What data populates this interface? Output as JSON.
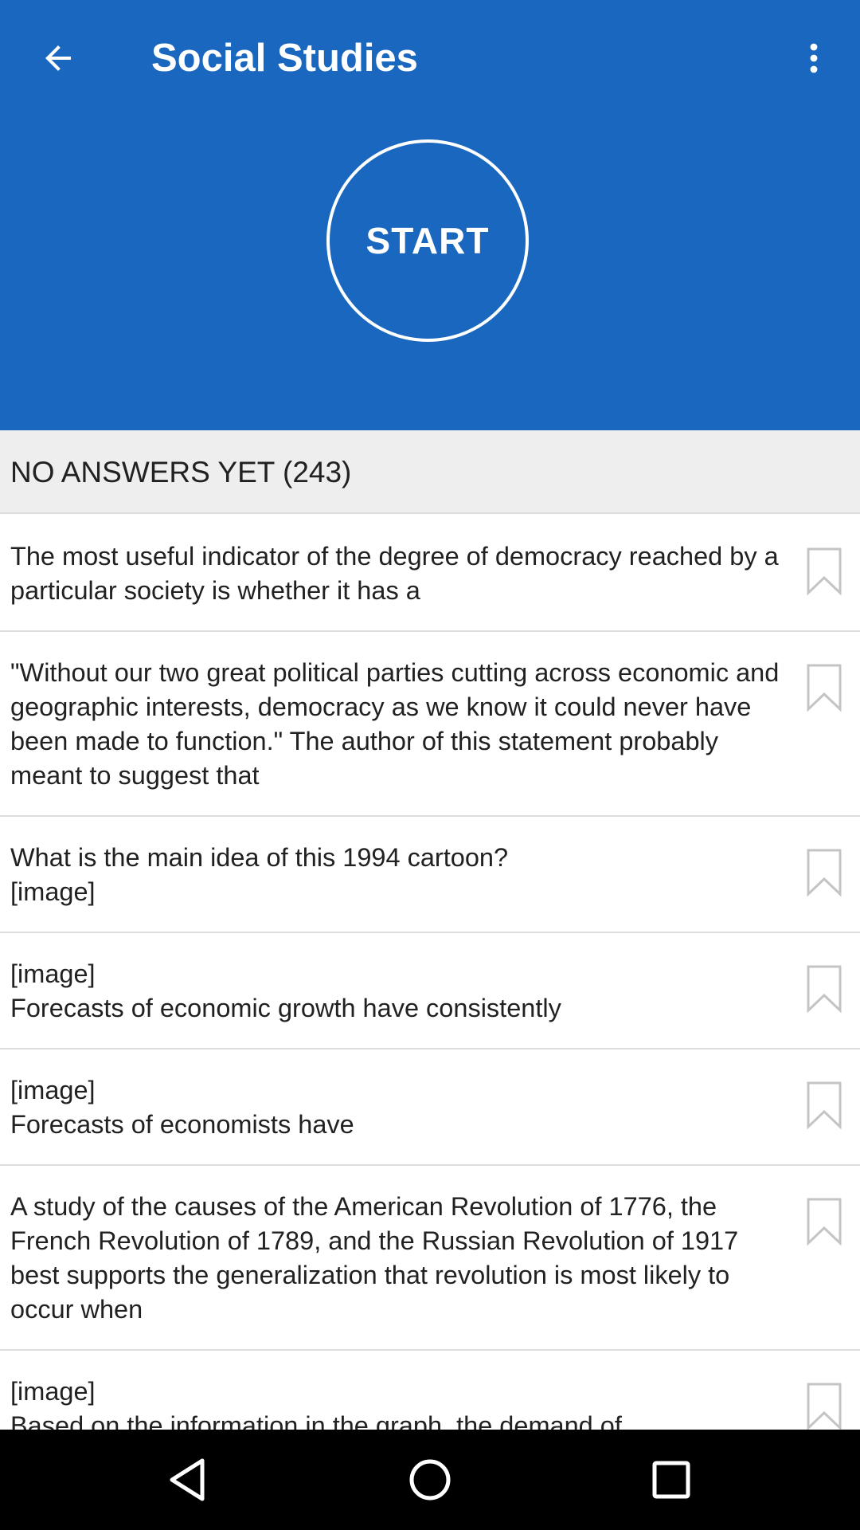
{
  "toolbar": {
    "title": "Social Studies",
    "back_icon": "arrow-left-icon",
    "menu_icon": "more-vert-icon"
  },
  "start": {
    "label": "START"
  },
  "section": {
    "title": "NO ANSWERS YET (243)"
  },
  "questions": [
    {
      "text": "The most useful indicator of the degree of democracy reached by a particular society is whether it has a"
    },
    {
      "text": "\"Without our two great political parties cutting across economic and geographic interests, democracy as we know it could never have been made to function.\" The author of this statement probably meant to suggest that"
    },
    {
      "text": "What is the main idea of this 1994 cartoon?\n[image]"
    },
    {
      "text": "[image]\nForecasts of economic growth have consistently"
    },
    {
      "text": "[image]\nForecasts of economists have"
    },
    {
      "text": "A study of the causes of the American Revolution of 1776, the French Revolution of 1789, and the Russian Revolution of 1917 best supports the generalization that revolution is most likely to occur when"
    },
    {
      "text": "[image]\nBased on the information in the graph, the demand of"
    }
  ],
  "navbar": {
    "back_icon": "nav-back-icon",
    "home_icon": "nav-home-icon",
    "recents_icon": "nav-recents-icon"
  },
  "colors": {
    "primary": "#1a67c0",
    "section_bg": "#eeeeee",
    "divider": "#dddddd",
    "text": "#212121"
  }
}
